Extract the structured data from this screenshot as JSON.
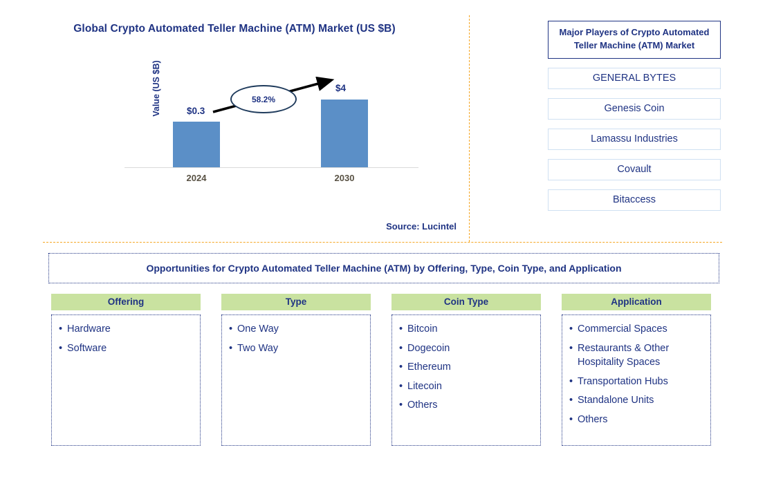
{
  "chart_panel": {
    "title": "Global Crypto Automated Teller Machine (ATM) Market (US $B)",
    "source": "Source: Lucintel"
  },
  "chart_data": {
    "type": "bar",
    "title": "Global Crypto Automated Teller Machine (ATM) Market (US $B)",
    "xlabel": "",
    "ylabel": "Value (US $B)",
    "categories": [
      "2024",
      "2030"
    ],
    "values": [
      0.3,
      4
    ],
    "value_labels": [
      "$0.3",
      "$4"
    ],
    "ylim": [
      0,
      4.8
    ],
    "grid": false,
    "legend": null,
    "annotations": [
      {
        "name": "cagr-bubble",
        "text": "58.2%",
        "description": "CAGR growth arrow from 2024 bar to 2030 bar"
      }
    ],
    "series": [
      {
        "name": "Value (US $B)",
        "values": [
          0.3,
          4
        ],
        "color": "#5b8fc7"
      }
    ],
    "source": "Source: Lucintel"
  },
  "players": {
    "header": "Major Players of Crypto Automated Teller Machine (ATM) Market",
    "items": [
      {
        "label": "GENERAL BYTES"
      },
      {
        "label": "Genesis Coin"
      },
      {
        "label": "Lamassu Industries"
      },
      {
        "label": "Covault"
      },
      {
        "label": "Bitaccess"
      }
    ]
  },
  "opportunities": {
    "title": "Opportunities for Crypto Automated Teller Machine (ATM) by Offering, Type, Coin Type, and Application",
    "columns": [
      {
        "header": "Offering",
        "items": [
          "Hardware",
          "Software"
        ]
      },
      {
        "header": "Type",
        "items": [
          "One Way",
          "Two Way"
        ]
      },
      {
        "header": "Coin Type",
        "items": [
          "Bitcoin",
          "Dogecoin",
          "Ethereum",
          "Litecoin",
          "Others"
        ]
      },
      {
        "header": "Application",
        "items": [
          "Commercial Spaces",
          "Restaurants & Other Hospitality Spaces",
          "Transportation Hubs",
          "Standalone Units",
          "Others"
        ]
      }
    ]
  },
  "colors": {
    "bar": "#5b8fc7",
    "navy": "#1f3383",
    "divider_orange": "#f5a623",
    "header_green": "#c9e2a0",
    "player_border": "#cfe0f2"
  }
}
